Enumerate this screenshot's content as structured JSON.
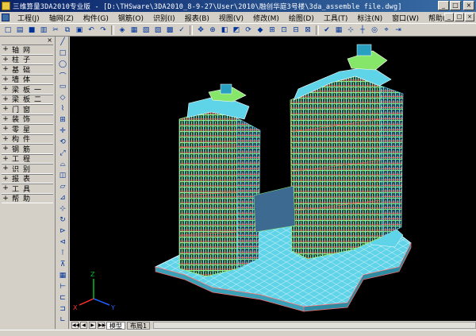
{
  "window": {
    "title": "三维算量3DA2010专业版 - [D:\\THSware\\3DA2010_8-9-27\\User\\2010\\融创华庭3号楼\\3da_assemble file.dwg]",
    "buttons": {
      "minimize": "_",
      "maximize": "□",
      "close": "×"
    }
  },
  "menu": {
    "items": [
      "工程(J)",
      "轴网(Z)",
      "构件(G)",
      "钢筋(O)",
      "识别(I)",
      "报表(B)",
      "视图(V)",
      "修改(M)",
      "绘图(D)",
      "工具(T)",
      "标注(N)",
      "窗口(W)",
      "帮助(H)"
    ]
  },
  "toolbar": {
    "icons": [
      "new-icon",
      "open-icon",
      "save-icon",
      "print-icon",
      "cut-icon",
      "copy-icon",
      "paste-icon",
      "undo-icon",
      "redo-icon",
      "layer-icon",
      "properties-icon",
      "calc-icon",
      "report-icon",
      "table-icon",
      "check-icon",
      "pan-icon",
      "zoom-icon",
      "3d-view-icon",
      "shade-icon",
      "orbit-icon",
      "cube-icon",
      "zoom-window-icon",
      "zoom-extent-icon",
      "zoom-prev-icon",
      "zoom-realtime-icon",
      "confirm-icon",
      "grid-icon",
      "snap-icon",
      "ortho-icon",
      "polar-icon",
      "osnap-icon",
      "track-icon"
    ],
    "glyphs": [
      "□",
      "▤",
      "■",
      "▥",
      "✂",
      "⧉",
      "▣",
      "↶",
      "↷",
      "◈",
      "▦",
      "▧",
      "▨",
      "▩",
      "✓",
      "✥",
      "⊕",
      "◧",
      "◩",
      "⟳",
      "◆",
      "⊞",
      "⊡",
      "⊟",
      "⊠",
      "✔",
      "▦",
      "⊹",
      "┼",
      "◎",
      "⌖",
      "⇥"
    ]
  },
  "left_panel": {
    "header": "×",
    "items": [
      {
        "mark": "+",
        "label": "轴网"
      },
      {
        "mark": "+",
        "label": "柱子"
      },
      {
        "mark": "+",
        "label": "基础"
      },
      {
        "mark": "+",
        "label": "墙体"
      },
      {
        "mark": "+",
        "label": "梁板一"
      },
      {
        "mark": "+",
        "label": "梁板二"
      },
      {
        "mark": "+",
        "label": "门窗"
      },
      {
        "mark": "+",
        "label": "装饰"
      },
      {
        "mark": "+",
        "label": "零星"
      },
      {
        "mark": "+",
        "label": "构件"
      },
      {
        "mark": "+",
        "label": "钢筋"
      },
      {
        "mark": "+",
        "label": "工程"
      },
      {
        "mark": "+",
        "label": "识别"
      },
      {
        "mark": "+",
        "label": "报表"
      },
      {
        "mark": "+",
        "label": "工具"
      },
      {
        "mark": "+",
        "label": "帮助"
      }
    ]
  },
  "vertical_toolbar": {
    "glyphs": [
      "╱",
      "□",
      "◯",
      "⌒",
      "▭",
      "◇",
      "⌇",
      "⊞",
      "✛",
      "⟲",
      "⤢",
      "⌓",
      "◫",
      "▱",
      "⊿",
      "⊹",
      "↻",
      "⊳",
      "⊲",
      "⊺",
      "⊼",
      "▦",
      "⊢",
      "⊏",
      "⊐",
      "∟",
      "⌐"
    ]
  },
  "viewport": {
    "background": "#000000",
    "ucs": {
      "x": "X",
      "y": "Y",
      "z": "Z"
    }
  },
  "bottom_tabs": {
    "nav": [
      "◀◀",
      "◀",
      "▶",
      "▶▶"
    ],
    "tabs": [
      {
        "label": "模型",
        "active": true
      },
      {
        "label": "布局1",
        "active": false
      }
    ]
  },
  "colors": {
    "title_start": "#0a246a",
    "title_end": "#3a6ea5",
    "chrome": "#d4d0c8",
    "slab": "#5fd3e8",
    "wall": "#8df07a",
    "beam": "#ff6a6a"
  }
}
